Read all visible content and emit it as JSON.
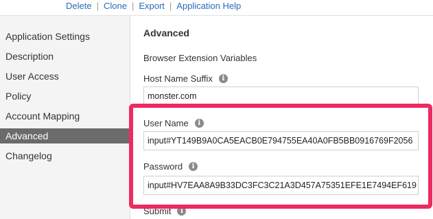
{
  "toolbar": {
    "delete_label": "Delete",
    "clone_label": "Clone",
    "export_label": "Export",
    "help_label": "Application Help",
    "separator": "|"
  },
  "sidebar": {
    "items": [
      {
        "label": "Application Settings",
        "active": false
      },
      {
        "label": "Description",
        "active": false
      },
      {
        "label": "User Access",
        "active": false
      },
      {
        "label": "Policy",
        "active": false
      },
      {
        "label": "Account Mapping",
        "active": false
      },
      {
        "label": "Advanced",
        "active": true
      },
      {
        "label": "Changelog",
        "active": false
      }
    ]
  },
  "main": {
    "title": "Advanced",
    "group_title": "Browser Extension Variables",
    "fields": {
      "host_name_suffix": {
        "label": "Host Name Suffix",
        "value": "monster.com"
      },
      "user_name": {
        "label": "User Name",
        "value": "input#YT149B9A0CA5EACB0E794755EA40A0FB5BB0916769F2056"
      },
      "password": {
        "label": "Password",
        "value": "input#HV7EAA8A9B33DC3FC3C21A3D457A75351EFE1E7494EF619"
      },
      "submit": {
        "label": "Submit"
      }
    },
    "info_glyph": "i"
  },
  "colors": {
    "link": "#2a6bb7",
    "sidebar_active_bg": "#6b6b6b",
    "highlight": "#ee2a61"
  }
}
